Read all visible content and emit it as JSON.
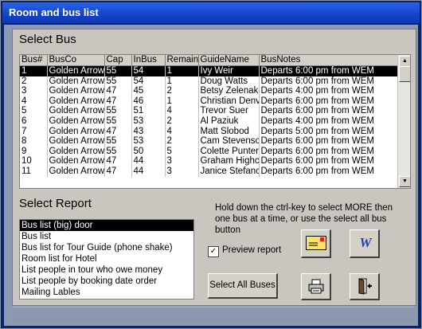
{
  "window": {
    "title": "Room and bus list"
  },
  "select_bus": {
    "caption": "Select Bus",
    "columns": [
      "Bus#",
      "BusCo",
      "Cap",
      "InBus",
      "Remain",
      "GuideName",
      "BusNotes"
    ],
    "rows": [
      [
        "1",
        "Golden Arrow",
        "55",
        "54",
        "1",
        "Ivy Weir",
        "Departs 6:00 pm from WEM"
      ],
      [
        "2",
        "Golden Arrow",
        "55",
        "54",
        "1",
        "Doug Watts",
        "Departs 6:00 pm from WEM"
      ],
      [
        "3",
        "Golden Arrow",
        "47",
        "45",
        "2",
        "Betsy Zelenak",
        "Departs 4:00 pm from WEM"
      ],
      [
        "4",
        "Golden Arrow",
        "47",
        "46",
        "1",
        "Christian Denvi",
        "Departs 6:00 pm from WEM"
      ],
      [
        "5",
        "Golden Arrow",
        "55",
        "51",
        "4",
        "Trevor Suer",
        "Departs 6:00 pm from WEM"
      ],
      [
        "6",
        "Golden Arrow",
        "55",
        "53",
        "2",
        "Al Paziuk",
        "Departs 4:00 pm from WEM"
      ],
      [
        "7",
        "Golden Arrow",
        "47",
        "43",
        "4",
        "Matt Slobod",
        "Departs 5:00 pm from WEM"
      ],
      [
        "8",
        "Golden Arrow",
        "55",
        "53",
        "2",
        "Cam Stevenson",
        "Departs 6:00 pm from WEM"
      ],
      [
        "9",
        "Golden Arrow",
        "55",
        "50",
        "5",
        "Colette Punter",
        "Departs 6:00 pm from WEM"
      ],
      [
        "10",
        "Golden Arrow",
        "47",
        "44",
        "3",
        "Graham Highcc",
        "Departs 6:00 pm from WEM"
      ],
      [
        "11",
        "Golden Arrow",
        "47",
        "44",
        "3",
        "Janice Stefanc",
        "Departs 6:00 pm from WEM"
      ]
    ],
    "selected_row": 0
  },
  "select_report": {
    "caption": "Select Report",
    "items": [
      "Bus list (big) door",
      "Bus list",
      "Bus list for Tour Guide (phone shake)",
      "Room list for Hotel",
      "List people in tour who owe money",
      "List people by booking date order",
      "Mailing Lables"
    ],
    "selected_index": 0
  },
  "hint_text": "Hold down the ctrl-key to select MORE then one bus at a time, or use the select all bus button",
  "preview": {
    "label": "Preview report",
    "checked": true,
    "check_glyph": "✓"
  },
  "buttons": {
    "select_all": "Select All Buses",
    "envelope_icon": "envelope-icon",
    "word_icon": "word-icon",
    "word_glyph": "W",
    "print_icon": "printer-icon",
    "exit_icon": "exit-door-icon"
  }
}
